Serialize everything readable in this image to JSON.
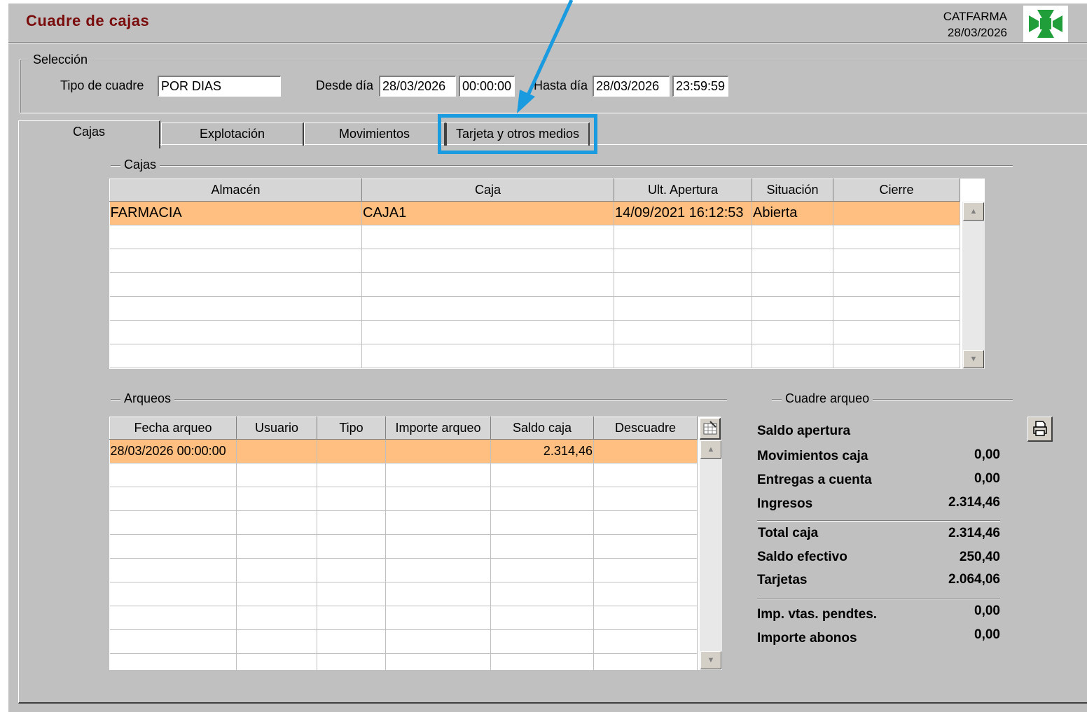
{
  "header": {
    "title": "Cuadre de cajas",
    "company": "CATFARMA",
    "date": "28/03/2026"
  },
  "seleccion": {
    "legend": "Selección",
    "tipo_label": "Tipo de cuadre",
    "tipo_value": "POR DIAS",
    "desde_label": "Desde día",
    "desde_fecha": "28/03/2026",
    "desde_hora": "00:00:00",
    "hasta_label": "Hasta día",
    "hasta_fecha": "28/03/2026",
    "hasta_hora": "23:59:59"
  },
  "tabs": [
    "Cajas",
    "Explotación",
    "Movimientos",
    "Tarjeta y otros medios"
  ],
  "cajas": {
    "legend": "Cajas",
    "columns": [
      "Almacén",
      "Caja",
      "Ult. Apertura",
      "Situación",
      "Cierre"
    ],
    "rows": [
      [
        "FARMACIA",
        "CAJA1",
        "14/09/2021 16:12:53",
        "Abierta",
        ""
      ]
    ]
  },
  "arqueos": {
    "legend": "Arqueos",
    "columns": [
      "Fecha arqueo",
      "Usuario",
      "Tipo",
      "Importe arqueo",
      "Saldo caja",
      "Descuadre"
    ],
    "rows": [
      [
        "28/03/2026 00:00:00",
        "",
        "",
        "",
        "2.314,46",
        ""
      ]
    ]
  },
  "cuadre": {
    "legend": "Cuadre arqueo",
    "items": [
      {
        "label": "Saldo apertura",
        "value": ""
      },
      {
        "label": "Movimientos caja",
        "value": "0,00"
      },
      {
        "label": "Entregas a cuenta",
        "value": "0,00"
      },
      {
        "label": "Ingresos",
        "value": "2.314,46"
      },
      {
        "label": "Total caja",
        "value": "2.314,46"
      },
      {
        "label": "Saldo efectivo",
        "value": "250,40"
      },
      {
        "label": "Tarjetas",
        "value": "2.064,06"
      },
      {
        "label": "Imp. vtas. pendtes.",
        "value": "0,00"
      },
      {
        "label": "Importe abonos",
        "value": "0,00"
      }
    ]
  },
  "colors": {
    "title": "#7a0c0c",
    "selected_row": "#ffbf80",
    "highlight": "#1a9be0",
    "logo_cross": "#1f9e3a"
  }
}
